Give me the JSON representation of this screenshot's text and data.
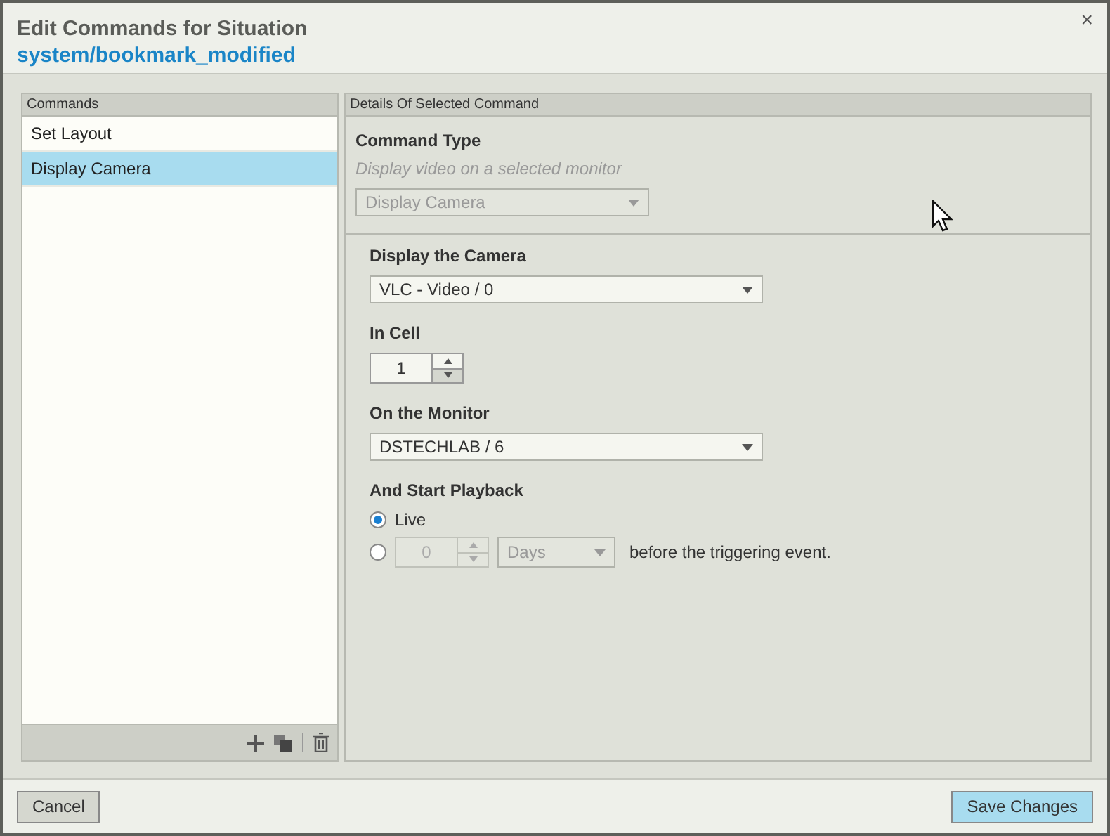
{
  "window": {
    "title": "Edit Commands for Situation",
    "subtitle": "system/bookmark_modified",
    "close": "×"
  },
  "commands": {
    "header": "Commands",
    "items": [
      {
        "label": "Set Layout",
        "selected": false
      },
      {
        "label": "Display Camera",
        "selected": true
      }
    ]
  },
  "details": {
    "header": "Details Of Selected Command",
    "command_type": {
      "label": "Command Type",
      "description": "Display video on a selected monitor",
      "value": "Display Camera",
      "disabled": true
    },
    "fields": [
      {
        "kind": "dropdown",
        "label": "Display the Camera",
        "value": "VLC - Video / 0"
      },
      {
        "kind": "spinner",
        "label": "In Cell",
        "value": "1"
      },
      {
        "kind": "dropdown",
        "label": "On the Monitor",
        "value": "DSTECHLAB / 6"
      }
    ],
    "playback": {
      "label": "And Start Playback",
      "options": [
        {
          "kind": "live",
          "label": "Live",
          "selected": true
        },
        {
          "kind": "offset",
          "amount": "0",
          "unit": "Days",
          "suffix": "before the triggering event.",
          "selected": false,
          "disabled": true
        }
      ]
    }
  },
  "buttons": [
    {
      "kind": "secondary",
      "label": "Cancel"
    },
    {
      "kind": "primary",
      "label": "Save Changes"
    }
  ]
}
